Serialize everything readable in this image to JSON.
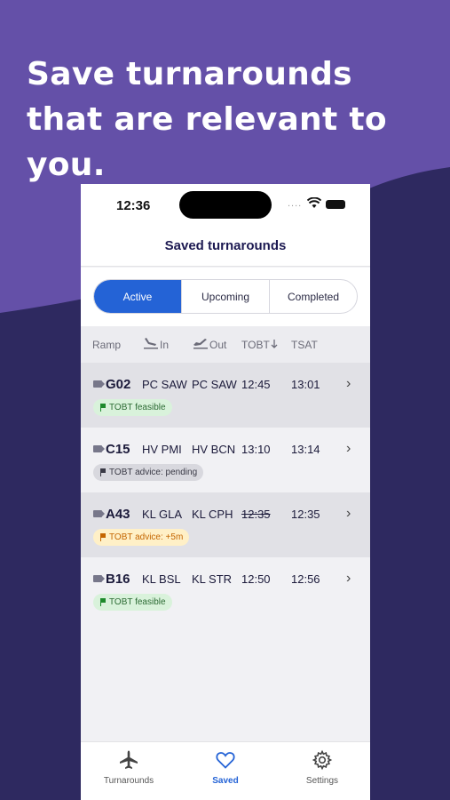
{
  "headline": "Save turnarounds that are relevant to you.",
  "colors": {
    "bg_top": "#6450a8",
    "bg_bottom": "#2e2960",
    "accent": "#2463d6",
    "feasible_bg": "#d9f2db",
    "feasible_fg": "#1e8a2c",
    "pending_bg": "#d8d8de",
    "pending_fg": "#3a3a46",
    "advice_bg": "#fff0c7",
    "advice_fg": "#c46500"
  },
  "status_bar": {
    "time": "12:36",
    "signal": "....",
    "wifi_icon": "wifi-icon",
    "battery_icon": "battery-icon"
  },
  "nav": {
    "title": "Saved turnarounds"
  },
  "segments": {
    "active": "Active",
    "upcoming": "Upcoming",
    "completed": "Completed",
    "selected": "Active"
  },
  "columns": {
    "ramp": "Ramp",
    "in": "In",
    "out": "Out",
    "tobt": "TOBT",
    "tsat": "TSAT"
  },
  "rows": [
    {
      "ramp": "G02",
      "in": "PC SAW",
      "out": "PC SAW",
      "tobt": "12:45",
      "tsat": "13:01",
      "badge": "TOBT feasible",
      "badge_type": "feasible"
    },
    {
      "ramp": "C15",
      "in": "HV PMI",
      "out": "HV BCN",
      "tobt": "13:10",
      "tsat": "13:14",
      "badge": "TOBT advice: pending",
      "badge_type": "pending"
    },
    {
      "ramp": "A43",
      "in": "KL GLA",
      "out": "KL CPH",
      "tobt": "12:35",
      "tsat": "12:35",
      "badge": "TOBT advice: +5m",
      "badge_type": "advice"
    },
    {
      "ramp": "B16",
      "in": "KL BSL",
      "out": "KL STR",
      "tobt": "12:50",
      "tsat": "12:56",
      "badge": "TOBT feasible",
      "badge_type": "feasible"
    }
  ],
  "tabs": [
    {
      "label": "Turnarounds",
      "icon": "airplane-icon"
    },
    {
      "label": "Saved",
      "icon": "heart-icon"
    },
    {
      "label": "Settings",
      "icon": "gear-icon"
    }
  ]
}
